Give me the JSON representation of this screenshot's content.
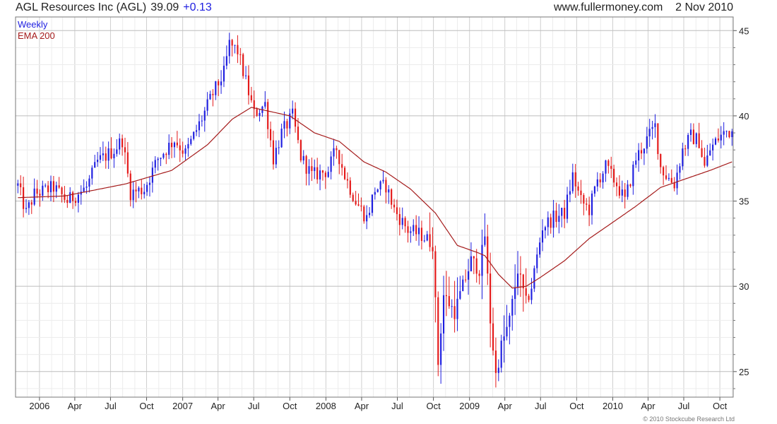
{
  "header": {
    "title": "AGL Resources Inc (AGL)",
    "price": "39.09",
    "change": "+0.13",
    "source": "www.fullermoney.com",
    "date": "2 Nov 2010"
  },
  "legend": {
    "weekly": "Weekly",
    "ema": "EMA 200"
  },
  "footer": {
    "copyright": "© 2010 Stockcube Research Ltd"
  },
  "colors": {
    "up": "#1e1ee0",
    "down": "#e41818",
    "ema": "#a51c1c",
    "grid": "#d9d9d9",
    "frame": "#777777"
  },
  "chart_data": {
    "type": "candlestick",
    "frequency": "weekly",
    "x_range": [
      "2005-11",
      "2010-11"
    ],
    "ylim": [
      23.5,
      45.8
    ],
    "y_ticks": [
      25,
      30,
      35,
      40,
      45
    ],
    "x_tick_labels": [
      {
        "date": "2006-01-01",
        "label": "2006"
      },
      {
        "date": "2006-04-01",
        "label": "Apr"
      },
      {
        "date": "2006-07-01",
        "label": "Jul"
      },
      {
        "date": "2006-10-01",
        "label": "Oct"
      },
      {
        "date": "2007-01-01",
        "label": "2007"
      },
      {
        "date": "2007-04-01",
        "label": "Apr"
      },
      {
        "date": "2007-07-01",
        "label": "Jul"
      },
      {
        "date": "2007-10-01",
        "label": "Oct"
      },
      {
        "date": "2008-01-01",
        "label": "2008"
      },
      {
        "date": "2008-04-01",
        "label": "Apr"
      },
      {
        "date": "2008-07-01",
        "label": "Jul"
      },
      {
        "date": "2008-10-01",
        "label": "Oct"
      },
      {
        "date": "2009-01-01",
        "label": "2009"
      },
      {
        "date": "2009-04-01",
        "label": "Apr"
      },
      {
        "date": "2009-07-01",
        "label": "Jul"
      },
      {
        "date": "2009-10-01",
        "label": "Oct"
      },
      {
        "date": "2010-01-01",
        "label": "2010"
      },
      {
        "date": "2010-04-01",
        "label": "Apr"
      },
      {
        "date": "2010-07-01",
        "label": "Jul"
      },
      {
        "date": "2010-10-01",
        "label": "Oct"
      }
    ],
    "close_keypoints": [
      [
        "2005-11-07",
        35.9
      ],
      [
        "2005-11-28",
        34.3
      ],
      [
        "2005-12-19",
        35.4
      ],
      [
        "2006-02-06",
        35.8
      ],
      [
        "2006-03-13",
        35.0
      ],
      [
        "2006-05-01",
        35.8
      ],
      [
        "2006-05-29",
        37.3
      ],
      [
        "2006-07-10",
        38.0
      ],
      [
        "2006-07-31",
        38.6
      ],
      [
        "2006-08-21",
        35.5
      ],
      [
        "2006-09-25",
        35.7
      ],
      [
        "2006-10-30",
        37.5
      ],
      [
        "2006-12-11",
        38.6
      ],
      [
        "2007-01-08",
        37.8
      ],
      [
        "2007-02-12",
        39.5
      ],
      [
        "2007-03-19",
        41.3
      ],
      [
        "2007-04-16",
        42.5
      ],
      [
        "2007-04-30",
        44.2
      ],
      [
        "2007-05-21",
        43.8
      ],
      [
        "2007-06-11",
        42.0
      ],
      [
        "2007-07-02",
        40.1
      ],
      [
        "2007-07-30",
        40.7
      ],
      [
        "2007-08-20",
        37.5
      ],
      [
        "2007-09-10",
        39.0
      ],
      [
        "2007-10-08",
        40.0
      ],
      [
        "2007-10-29",
        37.6
      ],
      [
        "2007-11-26",
        36.5
      ],
      [
        "2008-01-07",
        36.8
      ],
      [
        "2008-01-28",
        38.1
      ],
      [
        "2008-02-18",
        36.5
      ],
      [
        "2008-03-17",
        35.0
      ],
      [
        "2008-04-14",
        34.0
      ],
      [
        "2008-05-05",
        35.7
      ],
      [
        "2008-06-02",
        35.9
      ],
      [
        "2008-06-23",
        34.5
      ],
      [
        "2008-07-28",
        33.3
      ],
      [
        "2008-09-01",
        33.0
      ],
      [
        "2008-09-29",
        32.5
      ],
      [
        "2008-10-13",
        25.5
      ],
      [
        "2008-10-27",
        29.5
      ],
      [
        "2008-11-24",
        28.5
      ],
      [
        "2008-12-15",
        30.0
      ],
      [
        "2009-01-05",
        31.5
      ],
      [
        "2009-01-26",
        31.0
      ],
      [
        "2009-02-09",
        33.0
      ],
      [
        "2009-02-23",
        28.0
      ],
      [
        "2009-03-09",
        24.8
      ],
      [
        "2009-03-23",
        26.5
      ],
      [
        "2009-04-13",
        28.0
      ],
      [
        "2009-05-04",
        31.0
      ],
      [
        "2009-05-25",
        29.0
      ],
      [
        "2009-06-08",
        30.0
      ],
      [
        "2009-07-06",
        33.5
      ],
      [
        "2009-08-03",
        34.0
      ],
      [
        "2009-08-31",
        34.3
      ],
      [
        "2009-09-21",
        36.5
      ],
      [
        "2009-10-12",
        35.0
      ],
      [
        "2009-11-02",
        34.5
      ],
      [
        "2009-11-23",
        36.2
      ],
      [
        "2009-12-14",
        37.0
      ],
      [
        "2010-01-11",
        36.0
      ],
      [
        "2010-02-01",
        35.0
      ],
      [
        "2010-03-01",
        37.5
      ],
      [
        "2010-03-29",
        38.6
      ],
      [
        "2010-04-19",
        39.4
      ],
      [
        "2010-05-03",
        37.0
      ],
      [
        "2010-05-17",
        36.5
      ],
      [
        "2010-06-07",
        36.0
      ],
      [
        "2010-06-28",
        38.0
      ],
      [
        "2010-07-19",
        38.8
      ],
      [
        "2010-08-09",
        38.5
      ],
      [
        "2010-08-23",
        37.0
      ],
      [
        "2010-09-06",
        38.0
      ],
      [
        "2010-09-27",
        38.7
      ],
      [
        "2010-10-18",
        39.1
      ],
      [
        "2010-11-01",
        39.09
      ]
    ],
    "ema_keypoints": [
      [
        "2005-11-07",
        35.2
      ],
      [
        "2006-03-06",
        35.3
      ],
      [
        "2006-08-07",
        36.0
      ],
      [
        "2006-12-04",
        36.8
      ],
      [
        "2007-03-05",
        38.3
      ],
      [
        "2007-05-07",
        39.8
      ],
      [
        "2007-06-25",
        40.5
      ],
      [
        "2007-10-01",
        40.0
      ],
      [
        "2007-12-03",
        39.0
      ],
      [
        "2008-02-04",
        38.5
      ],
      [
        "2008-04-07",
        37.3
      ],
      [
        "2008-06-02",
        36.7
      ],
      [
        "2008-08-04",
        35.7
      ],
      [
        "2008-10-06",
        34.3
      ],
      [
        "2008-12-01",
        32.4
      ],
      [
        "2009-01-19",
        32.0
      ],
      [
        "2009-02-09",
        31.8
      ],
      [
        "2009-03-16",
        30.7
      ],
      [
        "2009-04-20",
        29.9
      ],
      [
        "2009-05-25",
        30.0
      ],
      [
        "2009-06-29",
        30.5
      ],
      [
        "2009-08-31",
        31.5
      ],
      [
        "2009-11-02",
        32.8
      ],
      [
        "2010-01-04",
        33.8
      ],
      [
        "2010-03-01",
        34.7
      ],
      [
        "2010-05-03",
        35.8
      ],
      [
        "2010-07-05",
        36.3
      ],
      [
        "2010-09-06",
        36.8
      ],
      [
        "2010-11-01",
        37.3
      ]
    ]
  }
}
